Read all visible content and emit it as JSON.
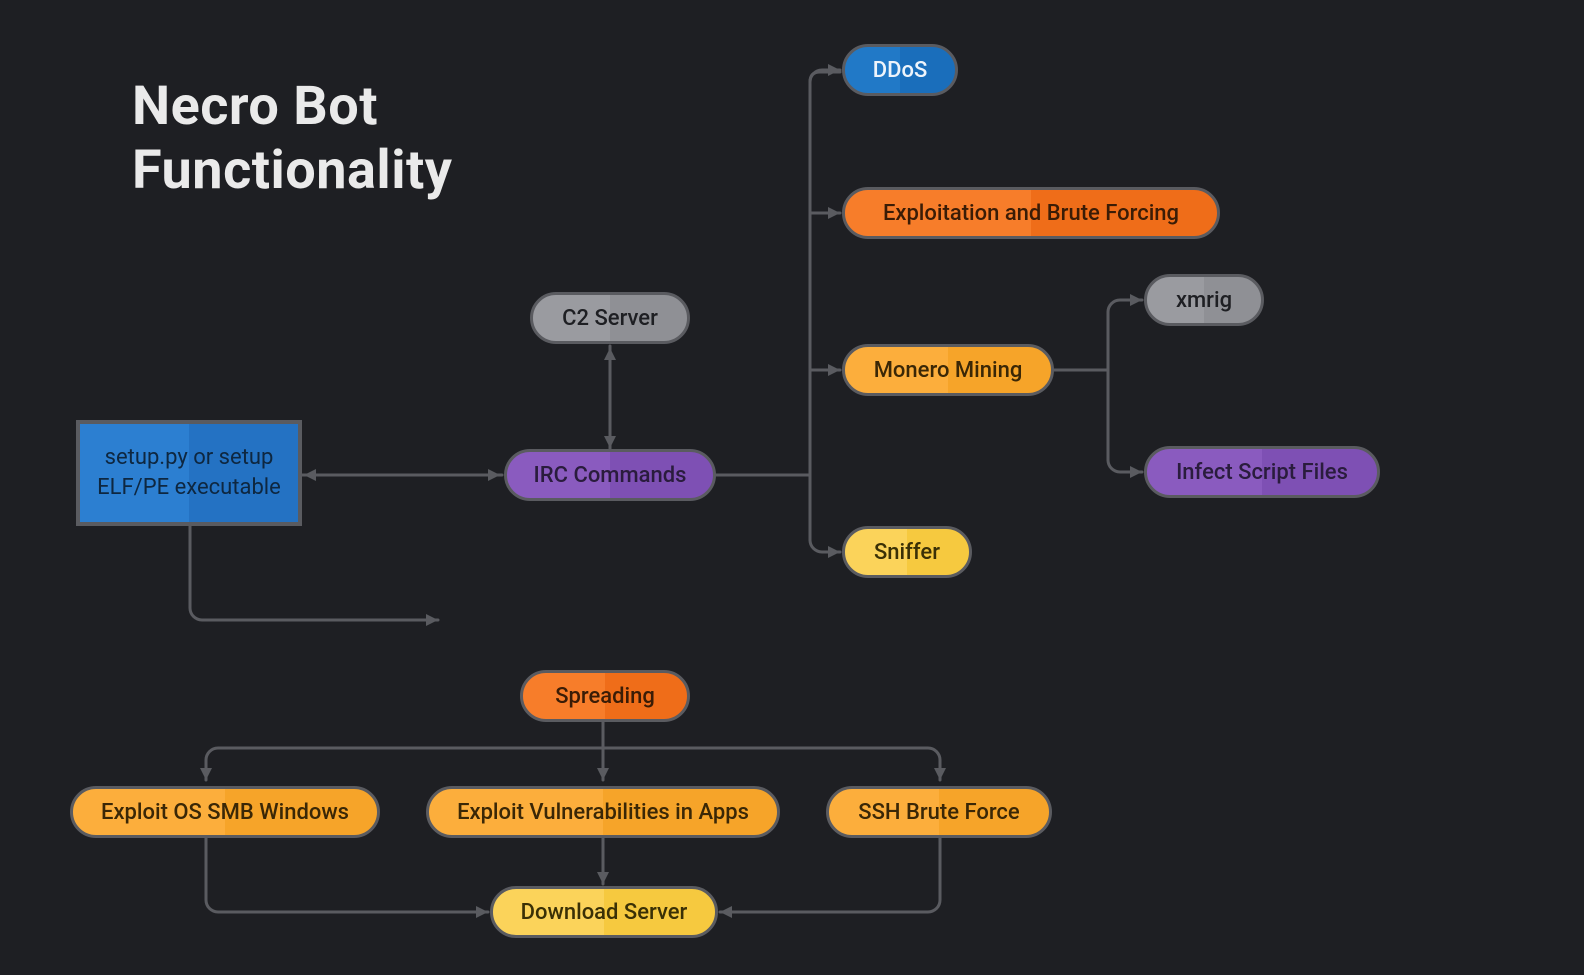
{
  "title_line1": "Necro Bot",
  "title_line2": "Functionality",
  "nodes": {
    "setup_exe_line1": "setup.py or setup",
    "setup_exe_line2": "ELF/PE executable",
    "c2_server": "C2 Server",
    "irc_commands": "IRC Commands",
    "ddos": "DDoS",
    "exploit_bf": "Exploitation and Brute Forcing",
    "monero": "Monero Mining",
    "sniffer": "Sniffer",
    "xmrig": "xmrig",
    "infect_scripts": "Infect Script Files",
    "spreading": "Spreading",
    "exploit_smb": "Exploit OS SMB Windows",
    "exploit_apps": "Exploit Vulnerabilities in Apps",
    "ssh_bf": "SSH Brute Force",
    "download_server": "Download Server"
  },
  "colors": {
    "bg": "#1e1f23",
    "border": "#5a5b60",
    "gray": "#9a9ba0",
    "purple": "#8a5bbf",
    "blue": "#2179c7",
    "orange": "#f77d2a",
    "amber": "#fcae3c",
    "yellow": "#fbd35a"
  }
}
